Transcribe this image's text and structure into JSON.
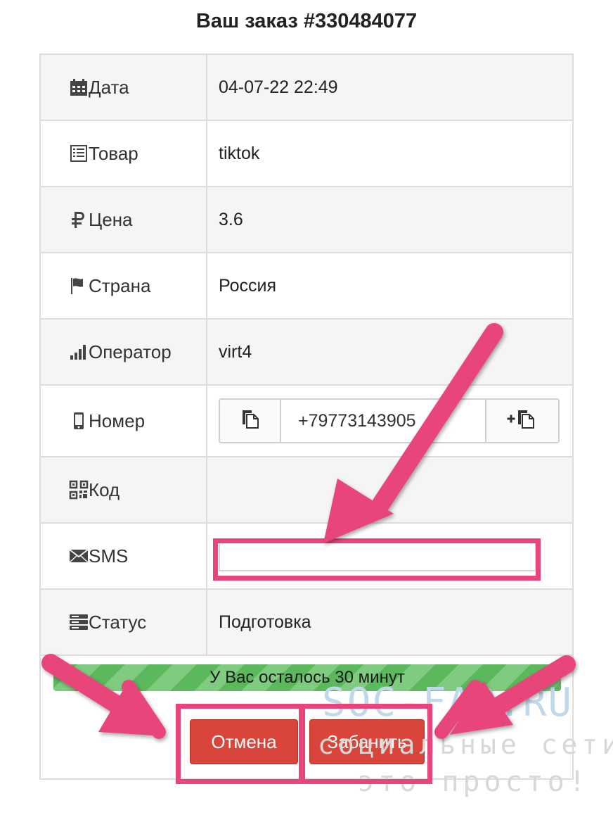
{
  "title": "Ваш заказ #330484077",
  "rows": [
    {
      "label": "Дата",
      "icon": "calendar-icon",
      "value": "04-07-22 22:49"
    },
    {
      "label": "Товар",
      "icon": "list-icon",
      "value": "tiktok"
    },
    {
      "label": "Цена",
      "icon": "ruble-icon",
      "value": "3.6"
    },
    {
      "label": "Страна",
      "icon": "flag-icon",
      "value": "Россия"
    },
    {
      "label": "Оператор",
      "icon": "signal-icon",
      "value": "virt4"
    },
    {
      "label": "Номер",
      "icon": "mobile-icon",
      "value": "+79773143905"
    },
    {
      "label": "Код",
      "icon": "qrcode-icon",
      "value": ""
    },
    {
      "label": "SMS",
      "icon": "envelope-icon",
      "value": ""
    },
    {
      "label": "Статус",
      "icon": "server-icon",
      "value": "Подготовка"
    }
  ],
  "progress": {
    "text": "У Вас осталось 30 минут",
    "color": "#5cb85c"
  },
  "buttons": {
    "cancel": "Отмена",
    "ban": "Забанить",
    "color": "#d9453a"
  },
  "watermark": {
    "line1": "SOC-FAQ.RU",
    "line2": "социальные сети",
    "line3": "это просто!"
  },
  "annotation_color": "#e8457a"
}
